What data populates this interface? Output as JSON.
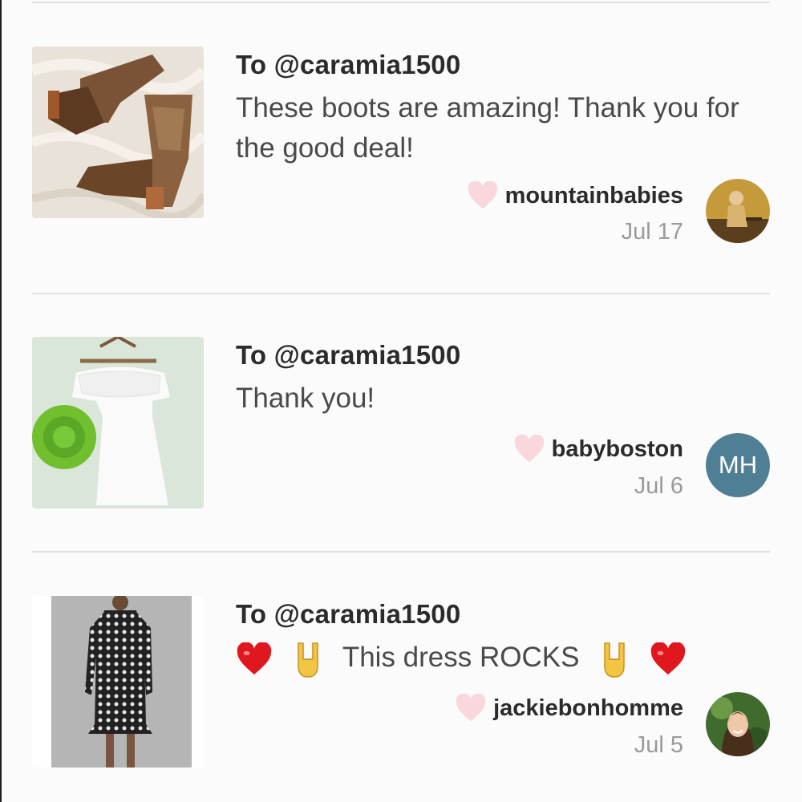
{
  "reviews": [
    {
      "to": "To @caramia1500",
      "message": "These boots are amazing! Thank you for the good deal!",
      "username": "mountainbabies",
      "date": "Jul 17",
      "thumbnail_icon": "cowboy-boots-photo"
    },
    {
      "to": "To @caramia1500",
      "message": "Thank you!",
      "username": "babyboston",
      "date": "Jul 6",
      "avatar_initials": "MH",
      "avatar_color": "#4f7f95",
      "thumbnail_icon": "white-dress-photo"
    },
    {
      "to": "To @caramia1500",
      "message": "This dress ROCKS",
      "username": "jackiebonhomme",
      "date": "Jul 5",
      "emojis": [
        "red-heart",
        "rock-on-hand",
        "rock-on-hand",
        "red-heart"
      ],
      "thumbnail_icon": "wrap-dress-photo"
    }
  ],
  "colors": {
    "heart": "#f9d7dc",
    "divider": "#e4dede",
    "background": "#fcfbfb"
  }
}
